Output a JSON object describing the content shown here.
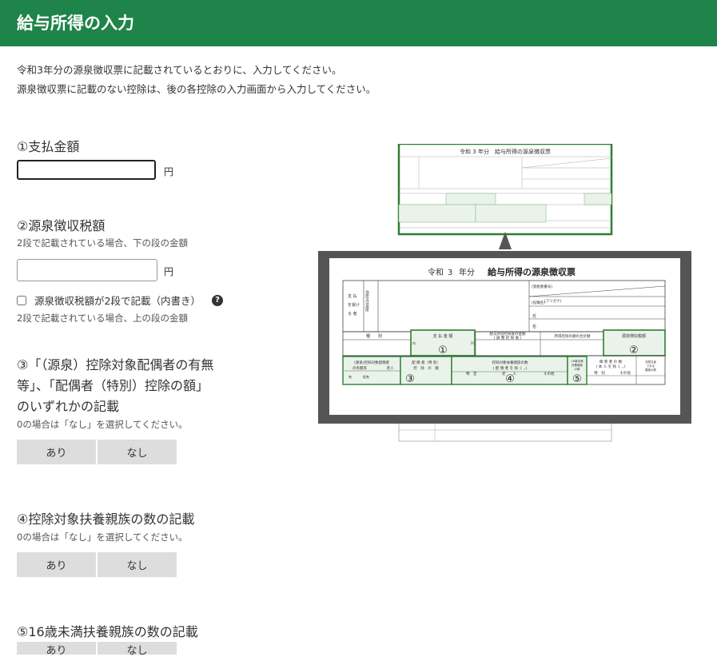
{
  "header": {
    "title": "給与所得の入力"
  },
  "intro": {
    "line1": "令和3年分の源泉徴収票に記載されているとおりに、入力してください。",
    "line2": "源泉徴収票に記載のない控除は、後の各控除の入力画面から入力してください。"
  },
  "q1": {
    "label": "①支払金額",
    "unit": "円",
    "value": ""
  },
  "q2": {
    "label": "②源泉徴収税額",
    "note": "2段で記載されている場合、下の段の金額",
    "unit": "円",
    "value": "",
    "checkbox_label": "源泉徴収税額が2段で記載（内書き）",
    "help_icon": "?",
    "checkbox_note": "2段で記載されている場合、上の段の金額"
  },
  "q3": {
    "label_line1": "③「（源泉）控除対象配偶者の有無",
    "label_line2": "等」、「配偶者（特別）控除の額」",
    "label_line3": "のいずれかの記載",
    "note": "0の場合は「なし」を選択してください。",
    "yes": "あり",
    "no": "なし"
  },
  "q4": {
    "label": "④控除対象扶養親族の数の記載",
    "note": "0の場合は「なし」を選択してください。",
    "yes": "あり",
    "no": "なし"
  },
  "q5": {
    "label": "⑤16歳未満扶養親族の数の記載",
    "yes": "あり",
    "no": "なし"
  },
  "figure": {
    "small_title": "令和 3 年分　給与所得の源泉徴収票",
    "era": "令和",
    "year": "3",
    "bun": "年分",
    "title": "給与所得の源泉徴収票",
    "payee_label1": "支 払",
    "payee_label2": "を受け",
    "payee_label3": "る 者",
    "address_label": "住所又は居所",
    "recipient_no": "(受給者番号)",
    "position": "(役職名)",
    "name_kana": "(フリガナ)",
    "shi": "氏",
    "mei": "名",
    "type": "種　　別",
    "pay_amount": "支 払 金 額",
    "after_deduction1": "給与所得控除後の金額",
    "after_deduction2": "( 調 整 控 除 後 )",
    "total_deduction": "所得控除の額の合計額",
    "tax_amount": "源泉徴収税額",
    "spouse_label1": "(源泉)控除対象配偶者",
    "spouse_label2": "の有無等",
    "elderly": "老人",
    "spouse_special1": "配 偶 者（特 別）",
    "spouse_special2": "控　除　の　額",
    "dependents1": "控除対象扶養親族の数",
    "dependents2": "( 配 偶 者 を 除 く 。)",
    "specific": "特　定",
    "elderly2": "老　　人",
    "other": "その他",
    "under16_1": "16歳未満",
    "under16_2": "扶養親族",
    "under16_3": "の数",
    "disabled1": "障 害 者 の 数",
    "disabled2": "( 本 人 を 除 く 。)",
    "special": "特　別",
    "other2": "その他",
    "nonresident1": "非居住者",
    "nonresident2": "である",
    "nonresident3": "親族の数",
    "yu": "有",
    "jyu": "従有",
    "en": "円",
    "sen": "千",
    "nin": "人",
    "jyuu": "従人",
    "uchi": "内",
    "m1": "①",
    "m2": "②",
    "m3": "③",
    "m4": "④",
    "m5": "⑤",
    "small_note1": "住所(居所)",
    "small_note2": "又は所在地",
    "small_note3": "氏名又は名称",
    "small_note4": "(摘要)"
  },
  "colors": {
    "header_bg": "#1e8449",
    "form_green": "#2e7d32",
    "callout_frame": "#555555"
  }
}
